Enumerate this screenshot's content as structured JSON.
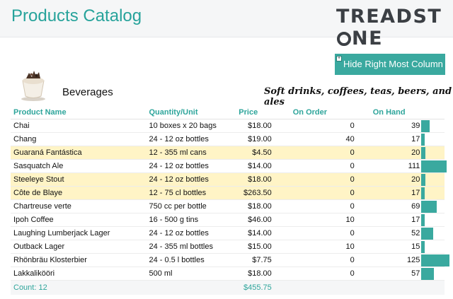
{
  "header": {
    "title": "Products Catalog",
    "logo": "TREADSTONE"
  },
  "hide_button": {
    "label": "Hide Right Most Column"
  },
  "category": {
    "name": "Beverages",
    "description": "Soft drinks, coffees, teas, beers, and ales"
  },
  "columns": {
    "name": "Product Name",
    "qty": "Quantity/Unit",
    "price": "Price",
    "order": "On Order",
    "hand": "On Hand"
  },
  "rows": [
    {
      "name": "Chai",
      "qty": "10 boxes x 20 bags",
      "price": "$18.00",
      "order": "0",
      "hand": "39",
      "stock": 39,
      "highlight": false
    },
    {
      "name": "Chang",
      "qty": "24 - 12 oz bottles",
      "price": "$19.00",
      "order": "40",
      "hand": "17",
      "stock": 17,
      "highlight": false
    },
    {
      "name": "Guaraná Fantástica",
      "qty": "12 - 355 ml cans",
      "price": "$4.50",
      "order": "0",
      "hand": "20",
      "stock": 20,
      "highlight": true
    },
    {
      "name": "Sasquatch Ale",
      "qty": "24 - 12 oz bottles",
      "price": "$14.00",
      "order": "0",
      "hand": "111",
      "stock": 111,
      "highlight": false
    },
    {
      "name": "Steeleye Stout",
      "qty": "24 - 12 oz bottles",
      "price": "$18.00",
      "order": "0",
      "hand": "20",
      "stock": 20,
      "highlight": true
    },
    {
      "name": "Côte de Blaye",
      "qty": "12 - 75 cl bottles",
      "price": "$263.50",
      "order": "0",
      "hand": "17",
      "stock": 17,
      "highlight": true
    },
    {
      "name": "Chartreuse verte",
      "qty": "750 cc per bottle",
      "price": "$18.00",
      "order": "0",
      "hand": "69",
      "stock": 69,
      "highlight": false
    },
    {
      "name": "Ipoh Coffee",
      "qty": "16 - 500 g tins",
      "price": "$46.00",
      "order": "10",
      "hand": "17",
      "stock": 17,
      "highlight": false
    },
    {
      "name": "Laughing Lumberjack Lager",
      "qty": "24 - 12 oz bottles",
      "price": "$14.00",
      "order": "0",
      "hand": "52",
      "stock": 52,
      "highlight": false
    },
    {
      "name": "Outback Lager",
      "qty": "24 - 355 ml bottles",
      "price": "$15.00",
      "order": "10",
      "hand": "15",
      "stock": 15,
      "highlight": false
    },
    {
      "name": "Rhönbräu Klosterbier",
      "qty": "24 - 0.5 l bottles",
      "price": "$7.75",
      "order": "0",
      "hand": "125",
      "stock": 125,
      "highlight": false
    },
    {
      "name": "Lakkalikööri",
      "qty": "500 ml",
      "price": "$18.00",
      "order": "0",
      "hand": "57",
      "stock": 57,
      "highlight": false
    }
  ],
  "footer": {
    "count": "Count: 12",
    "total": "$455.75"
  },
  "colors": {
    "accent": "#3aa99f",
    "highlight": "#fff4c6"
  },
  "icons": {
    "category_image": "coffee-cup-icon"
  }
}
